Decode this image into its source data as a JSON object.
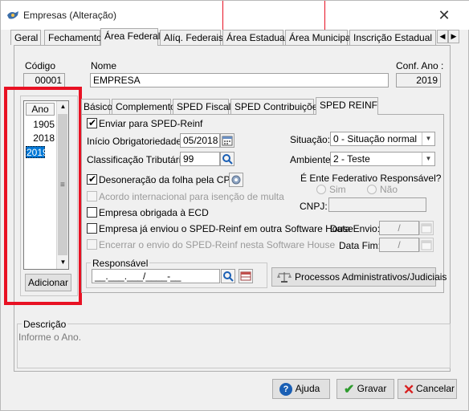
{
  "window": {
    "title": "Empresas (Alteração)"
  },
  "colors": {
    "highlight_red": "#e81123",
    "selection_blue": "#0078d7",
    "link_blue": "#1a5fb4"
  },
  "main_tabs": [
    {
      "label": "Geral"
    },
    {
      "label": "Fechamento"
    },
    {
      "label": "Área Federal"
    },
    {
      "label": "Alíq. Federais"
    },
    {
      "label": "Área Estadual"
    },
    {
      "label": "Área Municipal"
    },
    {
      "label": "Inscrição Estadual S"
    }
  ],
  "header_fields": {
    "codigo_label": "Código",
    "codigo_value": "00001",
    "nome_label": "Nome",
    "nome_value": "EMPRESA",
    "conf_ano_label": "Conf. Ano :",
    "conf_ano_value": "2019"
  },
  "year_list": {
    "header": "Ano",
    "items": [
      "1905",
      "2018",
      "2019"
    ],
    "selected": "2019"
  },
  "buttons": {
    "adicionar": "Adicionar",
    "processos": "Processos Administrativos/Judiciais",
    "ajuda": "Ajuda",
    "gravar": "Gravar",
    "cancelar": "Cancelar"
  },
  "sub_tabs": [
    {
      "label": "Básico"
    },
    {
      "label": "Complemento"
    },
    {
      "label": "SPED Fiscal"
    },
    {
      "label": "SPED Contribuições"
    },
    {
      "label": "SPED REINF"
    }
  ],
  "reinf": {
    "enviar_label": "Enviar para SPED-Reinf",
    "inicio_label": "Início Obrigatoriedade:",
    "inicio_value": "05/2018",
    "classificacao_label": "Classificação Tributária:",
    "classificacao_value": "99",
    "situacao_label": "Situação:",
    "situacao_value": "0 - Situação normal",
    "ambiente_label": "Ambiente:",
    "ambiente_value": "2 - Teste",
    "desoneracao_label": "Desoneração da folha pela CPRB",
    "acordo_label": "Acordo internacional para isenção de multa",
    "ecd_label": "Empresa obrigada à ECD",
    "enviou_label": "Empresa já enviou o SPED-Reinf em outra Software House",
    "encerrar_label": "Encerrar o envio do SPED-Reinf nesta Software House",
    "ente_label": "É Ente Federativo Responsável?",
    "sim_label": "Sim",
    "nao_label": "Não",
    "cnpj_label": "CNPJ:",
    "data_envio_label": "Data Envio:",
    "data_envio_value": "/",
    "data_fim_label": "Data Fim:",
    "data_fim_value": "/",
    "responsavel_label": "Responsável",
    "responsavel_value": "__.___.___/____-__"
  },
  "descricao": {
    "label": "Descrição",
    "text": "Informe o Ano."
  }
}
